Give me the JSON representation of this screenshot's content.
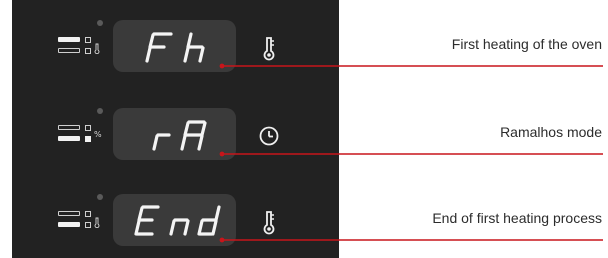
{
  "accent_color": "#c8151b",
  "rows": [
    {
      "display_text": "Fh",
      "caption": "First heating of the oven",
      "side_icon": "thermometer-icon",
      "indicator_glyph": "ꟸ",
      "indicator_bars": [
        "lit",
        "outline"
      ],
      "indicator_squares": [
        "outline",
        "outline"
      ]
    },
    {
      "display_text": "rA",
      "caption": "Ramalhos mode",
      "side_icon": "clock-icon",
      "indicator_glyph": "%",
      "indicator_bars": [
        "outline",
        "lit"
      ],
      "indicator_squares": [
        "outline",
        "lit"
      ]
    },
    {
      "display_text": "End",
      "caption": "End of first heating process",
      "side_icon": "thermometer-icon",
      "indicator_glyph": "ꟸ",
      "indicator_bars": [
        "outline",
        "lit"
      ],
      "indicator_squares": [
        "outline",
        "outline"
      ]
    }
  ]
}
